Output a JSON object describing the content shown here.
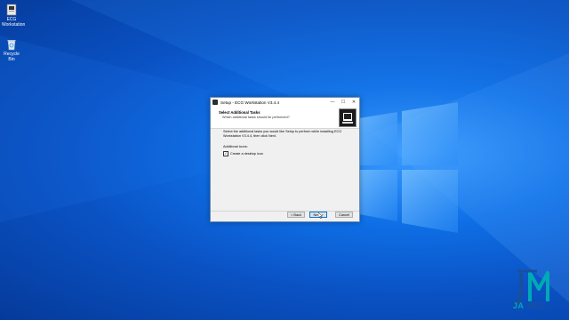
{
  "desktop": {
    "icons": [
      {
        "label": "ECG Workstation",
        "icon": "app-shortcut-icon"
      },
      {
        "label": "Recycle Bin",
        "icon": "recycle-bin-icon"
      }
    ]
  },
  "dialog": {
    "title": "Setup - ECG Workstation V3.4.4",
    "controls": {
      "minimize": "—",
      "maximize": "☐",
      "close": "✕"
    },
    "header": {
      "title": "Select Additional Tasks",
      "subtitle": "Which additional tasks should be performed?"
    },
    "body": {
      "description": "Select the additional tasks you would like Setup to perform while installing ECG Workstation V3.4.4, then click Next.",
      "group_label": "Additional icons:",
      "checkbox_label": "Create a desktop icon",
      "checkbox_checked": true,
      "check_glyph": "✓"
    },
    "buttons": {
      "back": "< Back",
      "next": "Next >",
      "cancel": "Cancel"
    }
  },
  "watermark": {
    "brand_ja": "JA",
    "brand_med": "MED"
  },
  "colors": {
    "accent": "#0078d7",
    "desktop_blue": "#0a52c4",
    "brand_teal": "#00a9b5",
    "brand_navy": "#1b4f9c"
  }
}
